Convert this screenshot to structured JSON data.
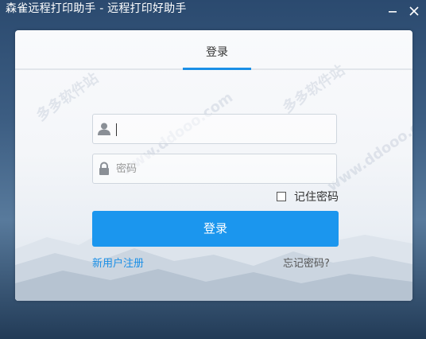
{
  "window": {
    "title": "森雀远程打印助手 - 远程打印好助手",
    "minimize_icon": "minimize-icon",
    "close_icon": "close-icon"
  },
  "tabs": [
    {
      "label": "登录",
      "active": true
    }
  ],
  "form": {
    "username": {
      "value": "",
      "placeholder": "",
      "icon": "user-icon"
    },
    "password": {
      "value": "",
      "placeholder": "密码",
      "icon": "lock-icon"
    },
    "remember_label": "记住密码",
    "remember_checked": false,
    "login_button": "登录"
  },
  "links": {
    "register": "新用户注册",
    "forgot": "忘记密码?"
  },
  "colors": {
    "accent": "#1b96ee",
    "link": "#1b8fe6",
    "background_top": "#2b4a6f",
    "background_bottom": "#223b57"
  }
}
